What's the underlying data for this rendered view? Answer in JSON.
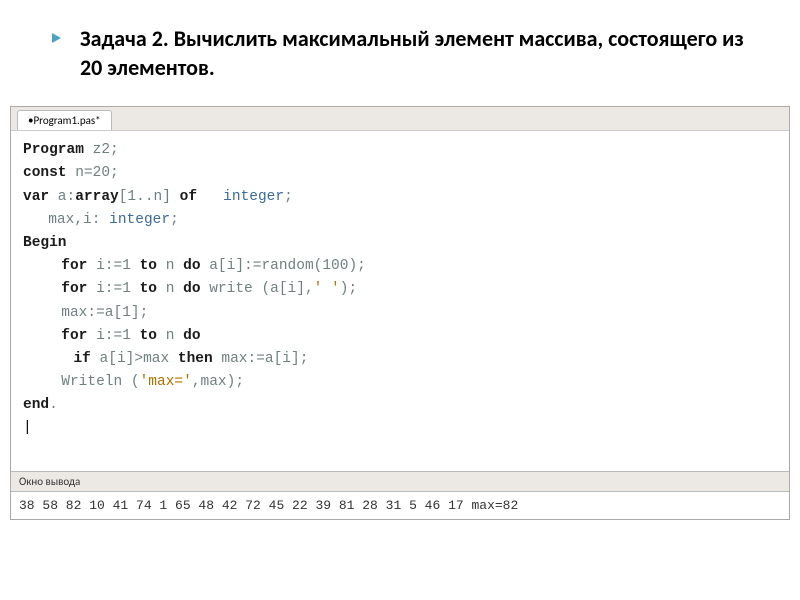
{
  "heading": "Задача 2. Вычислить максимальный элемент массива, состоящего из 20 элементов.",
  "bulletColor": "#4aa3c7",
  "ide": {
    "tab": "•Program1.pas*",
    "outputPanelTitle": "Окно вывода",
    "output": "38 58 82 10 41 74 1 65 48 42 72 45 22 39 81 28 31 5 46 17 max=82"
  },
  "code": {
    "line1_kw": "Program",
    "line1_rest": " z2;",
    "line2_kw": "const",
    "line2_rest": " n=20;",
    "line3_kw": "var",
    "line3_mid": " a:",
    "line3_arr": "array",
    "line3_br": "[1..n] ",
    "line3_of": "of",
    "line3_sp": "   ",
    "line3_type": "integer",
    "line3_semi": ";",
    "line4_var": "max,i: ",
    "line4_type": "integer",
    "line4_semi": ";",
    "line5_kw": "Begin",
    "line6_for": "for",
    "line6_mid": " i:=1 ",
    "line6_to": "to",
    "line6_n": " n ",
    "line6_do": "do",
    "line6_rest": " a[i]:=random(100);",
    "line7_for": "for",
    "line7_mid": " i:=1 ",
    "line7_to": "to",
    "line7_n": " n ",
    "line7_do": "do",
    "line7_rest": " write (a[i],",
    "line7_str": "' '",
    "line7_close": ");",
    "line8": "max:=a[1];",
    "line9_for": "for",
    "line9_mid": " i:=1 ",
    "line9_to": "to",
    "line9_n": " n ",
    "line9_do": "do",
    "line10_if": "if",
    "line10_cond": " a[i]>max ",
    "line10_then": "then",
    "line10_rest": " max:=a[i];",
    "line11_pre": "Writeln (",
    "line11_str": "'max='",
    "line11_post": ",max);",
    "line12_kw": "end",
    "line12_dot": ".",
    "line13_cursor": "|"
  }
}
